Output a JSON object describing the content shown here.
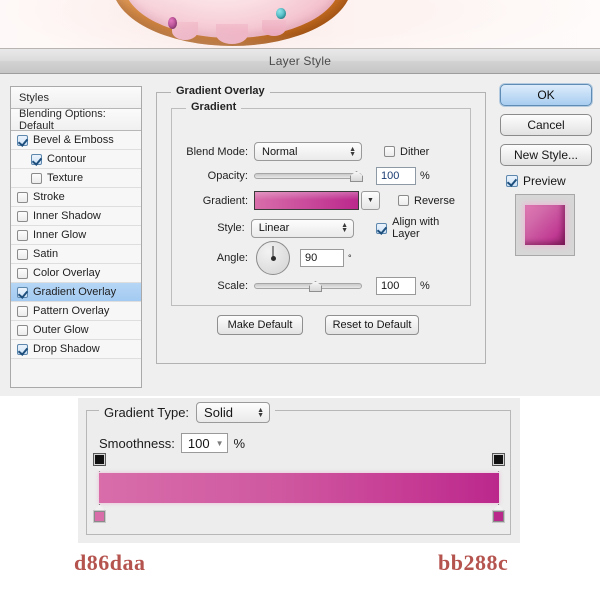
{
  "window": {
    "title": "Layer Style"
  },
  "styles_panel": {
    "header": "Styles",
    "blending_options": "Blending Options: Default",
    "items": [
      {
        "label": "Bevel & Emboss",
        "checked": true,
        "indent": false,
        "selected": false
      },
      {
        "label": "Contour",
        "checked": true,
        "indent": true,
        "selected": false
      },
      {
        "label": "Texture",
        "checked": false,
        "indent": true,
        "selected": false
      },
      {
        "label": "Stroke",
        "checked": false,
        "indent": false,
        "selected": false
      },
      {
        "label": "Inner Shadow",
        "checked": false,
        "indent": false,
        "selected": false
      },
      {
        "label": "Inner Glow",
        "checked": false,
        "indent": false,
        "selected": false
      },
      {
        "label": "Satin",
        "checked": false,
        "indent": false,
        "selected": false
      },
      {
        "label": "Color Overlay",
        "checked": false,
        "indent": false,
        "selected": false
      },
      {
        "label": "Gradient Overlay",
        "checked": true,
        "indent": false,
        "selected": true
      },
      {
        "label": "Pattern Overlay",
        "checked": false,
        "indent": false,
        "selected": false
      },
      {
        "label": "Outer Glow",
        "checked": false,
        "indent": false,
        "selected": false
      },
      {
        "label": "Drop Shadow",
        "checked": true,
        "indent": false,
        "selected": false
      }
    ]
  },
  "gradient_overlay": {
    "section_title": "Gradient Overlay",
    "group_title": "Gradient",
    "blend_mode": {
      "label": "Blend Mode:",
      "value": "Normal"
    },
    "dither": {
      "label": "Dither",
      "checked": false
    },
    "opacity": {
      "label": "Opacity:",
      "value": "100",
      "unit": "%",
      "slider_percent": 100
    },
    "gradient": {
      "label": "Gradient:",
      "start_color": "#d86daa",
      "end_color": "#bb288c"
    },
    "reverse": {
      "label": "Reverse",
      "checked": false
    },
    "style": {
      "label": "Style:",
      "value": "Linear"
    },
    "align_with_layer": {
      "label": "Align with Layer",
      "checked": true
    },
    "angle": {
      "label": "Angle:",
      "value": "90",
      "unit": "°"
    },
    "scale": {
      "label": "Scale:",
      "value": "100",
      "unit": "%",
      "slider_percent": 55
    },
    "make_default": "Make Default",
    "reset_to_default": "Reset to Default"
  },
  "buttons": {
    "ok": "OK",
    "cancel": "Cancel",
    "new_style": "New Style...",
    "preview": {
      "label": "Preview",
      "checked": true
    }
  },
  "preview_swatch": {
    "color_start": "#e07ab5",
    "color_end": "#8e1f68"
  },
  "gradient_editor": {
    "gradient_type": {
      "label": "Gradient Type:",
      "value": "Solid"
    },
    "smoothness": {
      "label": "Smoothness:",
      "value": "100",
      "unit": "%"
    },
    "bar": {
      "start_color": "#d86daa",
      "end_color": "#bb288c"
    },
    "stops": [
      {
        "position": 0,
        "opacity_stop_color": "#d86daa",
        "color_stop": "#000000"
      },
      {
        "position": 100,
        "opacity_stop_color": "#bb288c",
        "color_stop": "#000000"
      }
    ]
  },
  "annotations": {
    "left_hex": "d86daa",
    "right_hex": "bb288c",
    "hex_text_color": "#b5544f"
  }
}
